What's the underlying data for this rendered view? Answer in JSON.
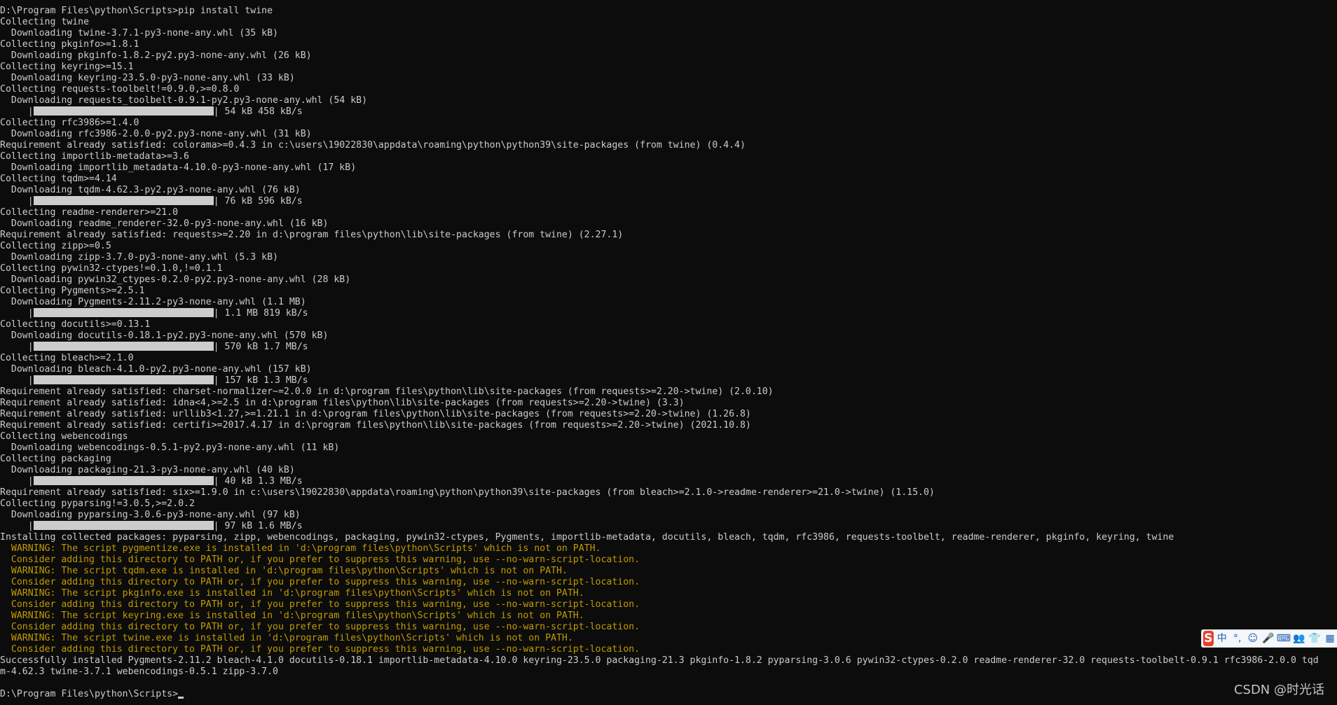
{
  "terminal": {
    "text_color": "#cccccc",
    "warning_color": "#c19c00",
    "background": "#0c0c0c",
    "lines": [
      {
        "text": "D:\\Program Files\\python\\Scripts>pip install twine"
      },
      {
        "text": "Collecting twine"
      },
      {
        "text": "  Downloading twine-3.7.1-py3-none-any.whl (35 kB)"
      },
      {
        "text": "Collecting pkginfo>=1.8.1"
      },
      {
        "text": "  Downloading pkginfo-1.8.2-py2.py3-none-any.whl (26 kB)"
      },
      {
        "text": "Collecting keyring>=15.1"
      },
      {
        "text": "  Downloading keyring-23.5.0-py3-none-any.whl (33 kB)"
      },
      {
        "text": "Collecting requests-toolbelt!=0.9.0,>=0.8.0"
      },
      {
        "text": "  Downloading requests_toolbelt-0.9.1-py2.py3-none-any.whl (54 kB)"
      },
      {
        "progress": true,
        "text": "| 54 kB 458 kB/s"
      },
      {
        "text": "Collecting rfc3986>=1.4.0"
      },
      {
        "text": "  Downloading rfc3986-2.0.0-py2.py3-none-any.whl (31 kB)"
      },
      {
        "text": "Requirement already satisfied: colorama>=0.4.3 in c:\\users\\19022830\\appdata\\roaming\\python\\python39\\site-packages (from twine) (0.4.4)"
      },
      {
        "text": "Collecting importlib-metadata>=3.6"
      },
      {
        "text": "  Downloading importlib_metadata-4.10.0-py3-none-any.whl (17 kB)"
      },
      {
        "text": "Collecting tqdm>=4.14"
      },
      {
        "text": "  Downloading tqdm-4.62.3-py2.py3-none-any.whl (76 kB)"
      },
      {
        "progress": true,
        "text": "| 76 kB 596 kB/s"
      },
      {
        "text": "Collecting readme-renderer>=21.0"
      },
      {
        "text": "  Downloading readme_renderer-32.0-py3-none-any.whl (16 kB)"
      },
      {
        "text": "Requirement already satisfied: requests>=2.20 in d:\\program files\\python\\lib\\site-packages (from twine) (2.27.1)"
      },
      {
        "text": "Collecting zipp>=0.5"
      },
      {
        "text": "  Downloading zipp-3.7.0-py3-none-any.whl (5.3 kB)"
      },
      {
        "text": "Collecting pywin32-ctypes!=0.1.0,!=0.1.1"
      },
      {
        "text": "  Downloading pywin32_ctypes-0.2.0-py2.py3-none-any.whl (28 kB)"
      },
      {
        "text": "Collecting Pygments>=2.5.1"
      },
      {
        "text": "  Downloading Pygments-2.11.2-py3-none-any.whl (1.1 MB)"
      },
      {
        "progress": true,
        "text": "| 1.1 MB 819 kB/s"
      },
      {
        "text": "Collecting docutils>=0.13.1"
      },
      {
        "text": "  Downloading docutils-0.18.1-py2.py3-none-any.whl (570 kB)"
      },
      {
        "progress": true,
        "text": "| 570 kB 1.7 MB/s"
      },
      {
        "text": "Collecting bleach>=2.1.0"
      },
      {
        "text": "  Downloading bleach-4.1.0-py2.py3-none-any.whl (157 kB)"
      },
      {
        "progress": true,
        "text": "| 157 kB 1.3 MB/s"
      },
      {
        "text": "Requirement already satisfied: charset-normalizer~=2.0.0 in d:\\program files\\python\\lib\\site-packages (from requests>=2.20->twine) (2.0.10)"
      },
      {
        "text": "Requirement already satisfied: idna<4,>=2.5 in d:\\program files\\python\\lib\\site-packages (from requests>=2.20->twine) (3.3)"
      },
      {
        "text": "Requirement already satisfied: urllib3<1.27,>=1.21.1 in d:\\program files\\python\\lib\\site-packages (from requests>=2.20->twine) (1.26.8)"
      },
      {
        "text": "Requirement already satisfied: certifi>=2017.4.17 in d:\\program files\\python\\lib\\site-packages (from requests>=2.20->twine) (2021.10.8)"
      },
      {
        "text": "Collecting webencodings"
      },
      {
        "text": "  Downloading webencodings-0.5.1-py2.py3-none-any.whl (11 kB)"
      },
      {
        "text": "Collecting packaging"
      },
      {
        "text": "  Downloading packaging-21.3-py3-none-any.whl (40 kB)"
      },
      {
        "progress": true,
        "text": "| 40 kB 1.3 MB/s"
      },
      {
        "text": "Requirement already satisfied: six>=1.9.0 in c:\\users\\19022830\\appdata\\roaming\\python\\python39\\site-packages (from bleach>=2.1.0->readme-renderer>=21.0->twine) (1.15.0)"
      },
      {
        "text": "Collecting pyparsing!=3.0.5,>=2.0.2"
      },
      {
        "text": "  Downloading pyparsing-3.0.6-py3-none-any.whl (97 kB)"
      },
      {
        "progress": true,
        "text": "| 97 kB 1.6 MB/s"
      },
      {
        "text": "Installing collected packages: pyparsing, zipp, webencodings, packaging, pywin32-ctypes, Pygments, importlib-metadata, docutils, bleach, tqdm, rfc3986, requests-toolbelt, readme-renderer, pkginfo, keyring, twine"
      },
      {
        "warn": true,
        "text": "  WARNING: The script pygmentize.exe is installed in 'd:\\program files\\python\\Scripts' which is not on PATH."
      },
      {
        "warn": true,
        "text": "  Consider adding this directory to PATH or, if you prefer to suppress this warning, use --no-warn-script-location."
      },
      {
        "warn": true,
        "text": "  WARNING: The script tqdm.exe is installed in 'd:\\program files\\python\\Scripts' which is not on PATH."
      },
      {
        "warn": true,
        "text": "  Consider adding this directory to PATH or, if you prefer to suppress this warning, use --no-warn-script-location."
      },
      {
        "warn": true,
        "text": "  WARNING: The script pkginfo.exe is installed in 'd:\\program files\\python\\Scripts' which is not on PATH."
      },
      {
        "warn": true,
        "text": "  Consider adding this directory to PATH or, if you prefer to suppress this warning, use --no-warn-script-location."
      },
      {
        "warn": true,
        "text": "  WARNING: The script keyring.exe is installed in 'd:\\program files\\python\\Scripts' which is not on PATH."
      },
      {
        "warn": true,
        "text": "  Consider adding this directory to PATH or, if you prefer to suppress this warning, use --no-warn-script-location."
      },
      {
        "warn": true,
        "text": "  WARNING: The script twine.exe is installed in 'd:\\program files\\python\\Scripts' which is not on PATH."
      },
      {
        "warn": true,
        "text": "  Consider adding this directory to PATH or, if you prefer to suppress this warning, use --no-warn-script-location."
      },
      {
        "text": "Successfully installed Pygments-2.11.2 bleach-4.1.0 docutils-0.18.1 importlib-metadata-4.10.0 keyring-23.5.0 packaging-21.3 pkginfo-1.8.2 pyparsing-3.0.6 pywin32-ctypes-0.2.0 readme-renderer-32.0 requests-toolbelt-0.9.1 rfc3986-2.0.0 tqd"
      },
      {
        "text": "m-4.62.3 twine-3.7.1 webencodings-0.5.1 zipp-3.7.0"
      },
      {
        "text": ""
      },
      {
        "prompt": true,
        "text": "D:\\Program Files\\python\\Scripts>"
      }
    ]
  },
  "ime_toolbar": {
    "logo": "S",
    "logo_color": "#e8402a",
    "items": [
      {
        "name": "ime-lang-toggle",
        "glyph": "中"
      },
      {
        "name": "ime-punctuation-icon",
        "glyph": "°,"
      },
      {
        "name": "ime-emoji-icon",
        "glyph": "☺"
      },
      {
        "name": "ime-voice-icon",
        "glyph": "🎤"
      },
      {
        "name": "ime-keyboard-icon",
        "glyph": "⌨"
      },
      {
        "name": "ime-user-icon",
        "glyph": "👥"
      },
      {
        "name": "ime-skin-icon",
        "glyph": "👕"
      },
      {
        "name": "ime-toolbox-icon",
        "glyph": "▦"
      }
    ]
  },
  "watermark": {
    "text": "CSDN @时光话"
  }
}
